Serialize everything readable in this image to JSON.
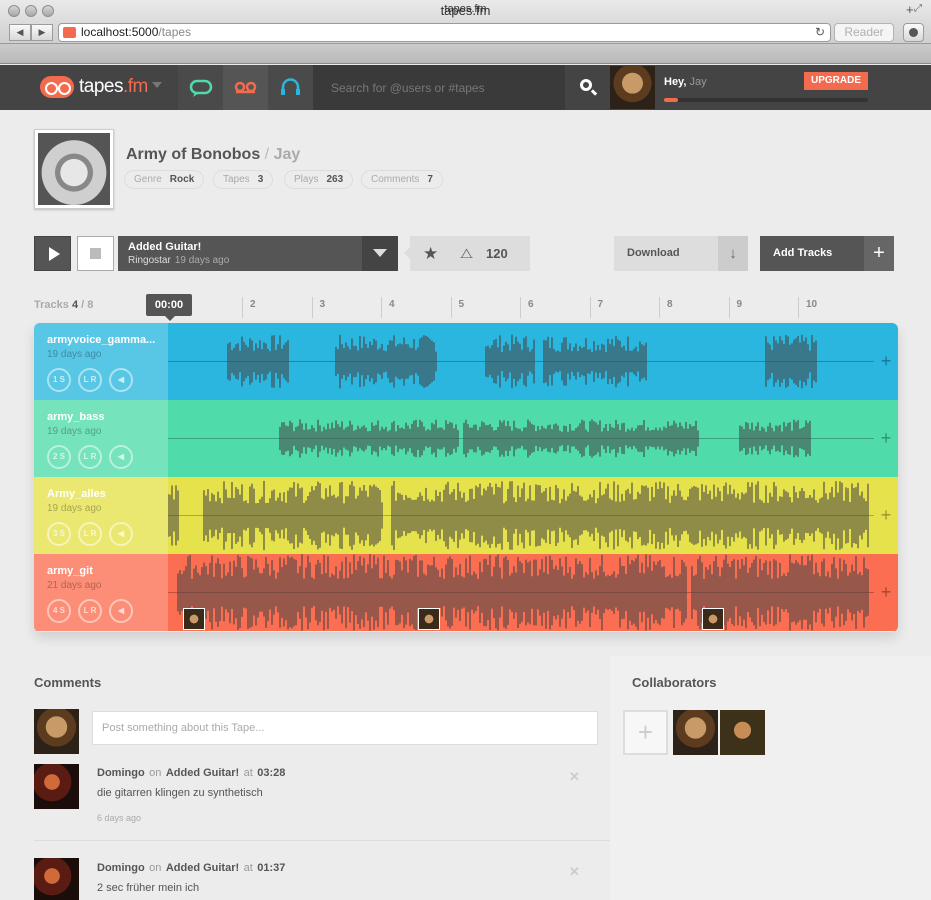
{
  "browser": {
    "window_title": "tapes.fm",
    "url_host": "localhost:5000",
    "url_path": "/tapes",
    "reader_label": "Reader",
    "tab_title": "tapes.fm",
    "reload_icon": "reload-icon"
  },
  "appbar": {
    "logo_prefix": "tapes",
    "logo_suffix": ".fm",
    "search_placeholder": "Search for @users or #tapes",
    "greeting": "Hey,",
    "user_name": "Jay",
    "upgrade_label": "UPGRADE",
    "storage_progress": 0.07,
    "icons": [
      "chat-icon",
      "tape-icon",
      "headphones-icon"
    ],
    "accent": "#f26b4f"
  },
  "tape": {
    "title": "Army of Bonobos",
    "separator": "/",
    "owner": "Jay",
    "genre_label": "Genre",
    "genre": "Rock",
    "tapes_label": "Tapes",
    "tapes": "3",
    "plays_label": "Plays",
    "plays": "263",
    "comments_label": "Comments",
    "comments": "7"
  },
  "transport": {
    "version_name": "Added Guitar!",
    "version_author": "Ringostar",
    "version_age": "19 days ago",
    "bpm": "120",
    "download_label": "Download",
    "add_tracks_label": "Add Tracks"
  },
  "ruler": {
    "tracks_shown": "4",
    "tracks_total": "8",
    "tracks_label": "Tracks",
    "current_time": "00:00",
    "ticks": [
      "2",
      "3",
      "4",
      "5",
      "6",
      "7",
      "8",
      "9",
      "10"
    ]
  },
  "tracks": [
    {
      "name": "armyvoice_gamma...",
      "age": "19 days ago",
      "num": "1",
      "color": "#2ab6de"
    },
    {
      "name": "army_bass",
      "age": "19 days ago",
      "num": "2",
      "color": "#4fdbaa"
    },
    {
      "name": "Army_alles",
      "age": "19 days ago",
      "num": "3",
      "color": "#e6e24b"
    },
    {
      "name": "army_git",
      "age": "21 days ago",
      "num": "4",
      "color": "#fb6e51"
    }
  ],
  "knob_labels": {
    "solo": "S",
    "pan": "L R"
  },
  "comments": {
    "heading": "Comments",
    "placeholder": "Post something about this Tape...",
    "items": [
      {
        "author": "Domingo",
        "on": "on",
        "version": "Added Guitar!",
        "at": "at",
        "time": "03:28",
        "body": "die gitarren klingen zu synthetisch",
        "age": "6 days ago"
      },
      {
        "author": "Domingo",
        "on": "on",
        "version": "Added Guitar!",
        "at": "at",
        "time": "01:37",
        "body": "2 sec früher mein ich",
        "age": ""
      }
    ]
  },
  "collaborators": {
    "heading": "Collaborators"
  }
}
